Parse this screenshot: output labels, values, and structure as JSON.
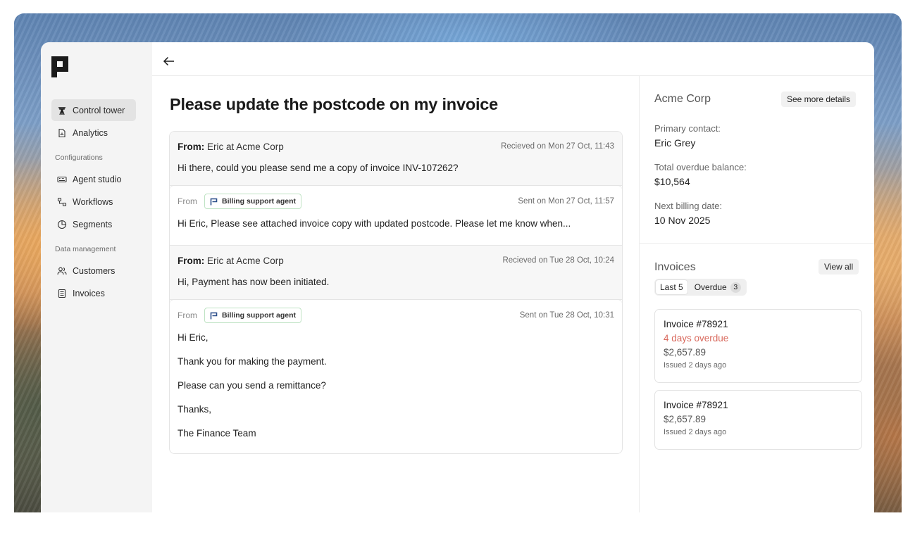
{
  "sidebar": {
    "items": [
      {
        "label": "Control tower",
        "icon": "tower-icon",
        "active": true
      },
      {
        "label": "Analytics",
        "icon": "chart-file-icon"
      }
    ],
    "configurations": {
      "heading": "Configurations",
      "items": [
        {
          "label": "Agent studio",
          "icon": "keyboard-icon"
        },
        {
          "label": "Workflows",
          "icon": "workflow-icon"
        },
        {
          "label": "Segments",
          "icon": "pie-icon"
        }
      ]
    },
    "data_management": {
      "heading": "Data management",
      "items": [
        {
          "label": "Customers",
          "icon": "users-icon"
        },
        {
          "label": "Invoices",
          "icon": "document-icon"
        }
      ]
    }
  },
  "page": {
    "title": "Please update the postcode on my invoice"
  },
  "thread": {
    "messages": [
      {
        "from_prefix": "From:",
        "from_name": "Eric at Acme Corp",
        "stamp": "Recieved on Mon 27 Oct, 11:43",
        "body": "Hi there, could you please send me a copy of invoice INV-107262?"
      },
      {
        "from_prefix": "From",
        "agent": "Billing support agent",
        "stamp": "Sent on Mon 27 Oct, 11:57",
        "body": "Hi Eric, Please see attached invoice copy with updated postcode. Please let me know when..."
      },
      {
        "from_prefix": "From:",
        "from_name": "Eric at Acme Corp",
        "stamp": "Recieved on Tue 28 Oct, 10:24",
        "body": "Hi, Payment has now been initiated."
      },
      {
        "from_prefix": "From",
        "agent": "Billing support agent",
        "stamp": "Sent on Tue 28 Oct, 10:31",
        "lines": [
          "Hi Eric,",
          "Thank you for making the payment.",
          "Please can you send a remittance?",
          "Thanks,",
          "The Finance Team"
        ]
      }
    ]
  },
  "details": {
    "company": "Acme Corp",
    "see_more": "See more details",
    "primary_contact_label": "Primary contact:",
    "primary_contact": "Eric Grey",
    "overdue_label": "Total overdue balance:",
    "overdue_value": "$10,564",
    "billing_label": "Next billing date:",
    "billing_value": "10 Nov 2025"
  },
  "invoices": {
    "title": "Invoices",
    "view_all": "View all",
    "filters": [
      {
        "label": "Last 5",
        "active": true
      },
      {
        "label": "Overdue",
        "count": "3"
      }
    ],
    "cards": [
      {
        "title": "Invoice #78921",
        "status": "4 days overdue",
        "amount": "$2,657.89",
        "issued": "Issued 2 days ago"
      },
      {
        "title": "Invoice #78921",
        "amount": "$2,657.89",
        "issued": "Issued 2 days ago"
      }
    ]
  },
  "colors": {
    "overdue": "#d96a5e",
    "agent_badge_border": "#bfe3c4",
    "active_nav": "#e3e3e3"
  }
}
